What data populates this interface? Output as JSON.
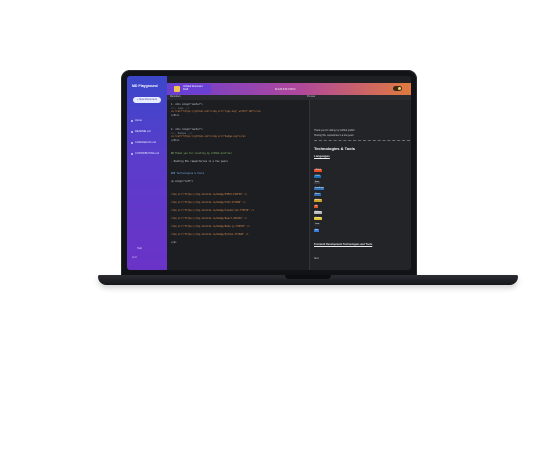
{
  "sidebar": {
    "brand": "MD Playground",
    "new_button": "+ New Document",
    "links": [
      "Home",
      "README.md",
      "CHANGELOG.md",
      "CONTRIBUTING.md"
    ],
    "footer": "Help",
    "footer_user": "v1.0"
  },
  "header": {
    "tab_title": "Untitled Document",
    "tab_subtitle": "Draft",
    "title": "MARKDOWN"
  },
  "subbar": {
    "left": "Markdown",
    "middle": "Preview"
  },
  "editor": {
    "lines": [
      "1. <div align=\"center\">",
      "    <!-- Logo -->",
      "    <a href=\"https://github.com\"><img src=\"logo.svg\" width=\"120\"></a>",
      "</div>",
      "",
      "2. <div align=\"center\">",
      "    <!-- Badges -->",
      "    <a href=\"https://github.com\"><img src=\"badge.svg\"></a>",
      "</div>",
      "",
      "## Thank you for visiting my GitHub profile!",
      "",
      "- Hosting 50+ repositories in a few years",
      "",
      "### Technologies & Tools",
      "",
      "<p align=\"left\">",
      "",
      "<img src=\"https://img.shields.io/badge/HTML5-E34F26\" />",
      "<img src=\"https://img.shields.io/badge/CSS3-1572B6\" />",
      "<img src=\"https://img.shields.io/badge/JavaScript-F7DF1E\" />",
      "<img src=\"https://img.shields.io/badge/React-20232A\" />",
      "<img src=\"https://img.shields.io/badge/Node.js-339933\" />",
      "<img src=\"https://img.shields.io/badge/Python-3776AB\" />",
      "</p>"
    ]
  },
  "preview": {
    "bullet1": "Thank you for visiting my GitHub profile!",
    "bullet2": "Hosting 50+ repositories in a few years",
    "heading": "Technologies & Tools",
    "subheading": "Languages",
    "badges": [
      {
        "label": "HTML5",
        "color": "#e34f26"
      },
      {
        "label": "CSS3",
        "color": "#1572b6"
      },
      {
        "label": "Sass",
        "color": "#3a3b40"
      },
      {
        "label": "JavaScript",
        "color": "#2f6fb5"
      },
      {
        "label": "React",
        "color": "#2b6cb0"
      },
      {
        "label": "Node.js",
        "color": "#c9a227"
      },
      {
        "label": "Git",
        "color": "#d95a2b"
      },
      {
        "label": "Python",
        "color": "#b8b8c0"
      },
      {
        "label": "Docker",
        "color": "#e0c33a"
      },
      {
        "label": "Linux",
        "color": "#2a2b30"
      },
      {
        "label": "Vue",
        "color": "#3d7be0"
      }
    ],
    "section2": "Frontend Development Technologies and Tools",
    "footer": "Next"
  },
  "colors": {
    "sidebar_top": "#3b47c9",
    "header_start": "#6b3fd1",
    "header_end": "#e07a3f",
    "editor_bg": "#1d1e22"
  }
}
